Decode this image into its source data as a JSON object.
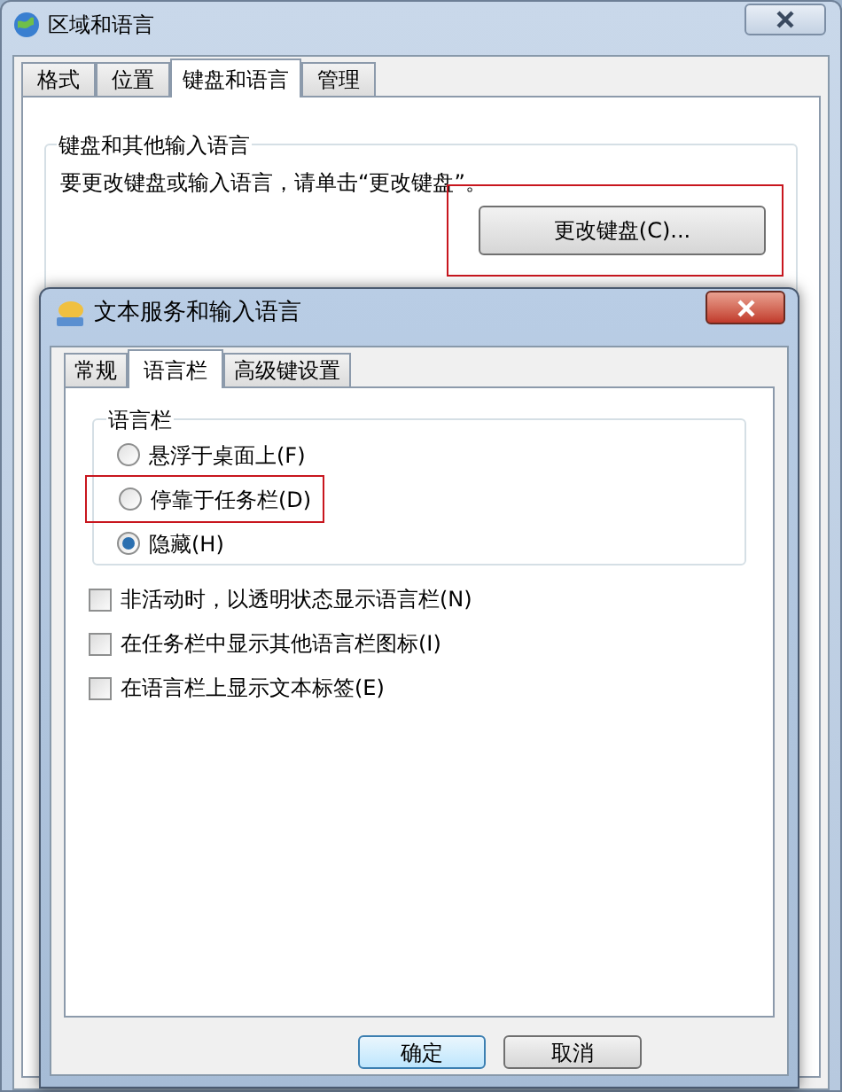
{
  "window": {
    "title": "区域和语言"
  },
  "tabs": [
    {
      "label": "格式",
      "selected": false
    },
    {
      "label": "位置",
      "selected": false
    },
    {
      "label": "键盘和语言",
      "selected": true
    },
    {
      "label": "管理",
      "selected": false
    }
  ],
  "keyboard_group": {
    "title": "键盘和其他输入语言",
    "description": "要更改键盘或输入语言，请单击“更改键盘”。",
    "button": {
      "label": "更改键盘(C)...",
      "highlighted": true
    }
  },
  "dialog": {
    "title": "文本服务和输入语言",
    "tabs": [
      {
        "label": "常规",
        "selected": false
      },
      {
        "label": "语言栏",
        "selected": true
      },
      {
        "label": "高级键设置",
        "selected": false
      }
    ],
    "language_bar_group": {
      "title": "语言栏",
      "options": [
        {
          "label": "悬浮于桌面上(F)",
          "selected": false,
          "highlighted": false
        },
        {
          "label": "停靠于任务栏(D)",
          "selected": false,
          "highlighted": true
        },
        {
          "label": "隐藏(H)",
          "selected": true,
          "highlighted": false
        }
      ]
    },
    "checkboxes": [
      {
        "label": "非活动时，以透明状态显示语言栏(N)",
        "checked": false
      },
      {
        "label": "在任务栏中显示其他语言栏图标(I)",
        "checked": false
      },
      {
        "label": "在语言栏上显示文本标签(E)",
        "checked": false
      }
    ],
    "buttons": [
      {
        "label": "确定",
        "default": true
      },
      {
        "label": "取消",
        "default": false
      }
    ]
  }
}
